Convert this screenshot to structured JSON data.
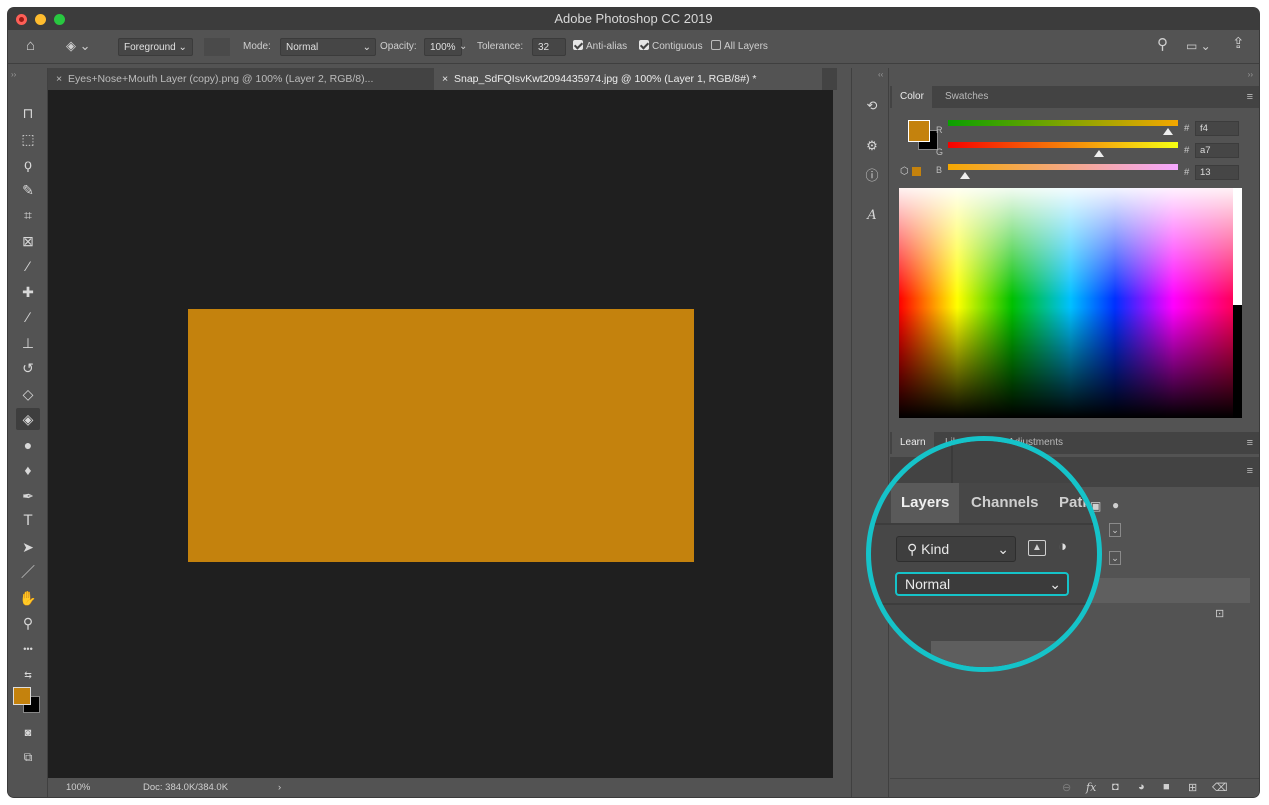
{
  "window": {
    "title": "Adobe Photoshop CC 2019"
  },
  "options_bar": {
    "fill_source": "Foreground",
    "mode_label": "Mode:",
    "mode_value": "Normal",
    "opacity_label": "Opacity:",
    "opacity_value": "100%",
    "tolerance_label": "Tolerance:",
    "tolerance_value": "32",
    "anti_alias_label": "Anti-alias",
    "anti_alias_checked": true,
    "contiguous_label": "Contiguous",
    "contiguous_checked": true,
    "all_layers_label": "All Layers",
    "all_layers_checked": false
  },
  "document_tabs": [
    {
      "label": "Eyes+Nose+Mouth Layer (copy).png @ 100% (Layer 2, RGB/8)...",
      "active": false
    },
    {
      "label": "Snap_SdFQIsvKwt2094435974.jpg @ 100% (Layer 1, RGB/8#) *",
      "active": true
    }
  ],
  "tools": [
    "artboard-tool-icon",
    "marquee-tool-icon",
    "lasso-tool-icon",
    "quick-selection-tool-icon",
    "crop-tool-icon",
    "frame-tool-icon",
    "eyedropper-tool-icon",
    "healing-brush-tool-icon",
    "brush-tool-icon",
    "clone-stamp-tool-icon",
    "history-brush-tool-icon",
    "eraser-tool-icon",
    "paint-bucket-tool-icon",
    "blur-tool-icon",
    "dodge-tool-icon",
    "pen-tool-icon",
    "type-tool-icon",
    "path-selection-tool-icon",
    "line-tool-icon",
    "hand-tool-icon",
    "zoom-tool-icon",
    "more-tools-icon"
  ],
  "selected_tool": "paint-bucket-tool-icon",
  "canvas": {
    "fill_color": "#c4820d"
  },
  "status_bar": {
    "zoom": "100%",
    "doc_size": "Doc: 384.0K/384.0K"
  },
  "color_panel": {
    "tabs": [
      "Color",
      "Swatches"
    ],
    "active_tab": "Color",
    "foreground": "#c4820d",
    "background": "#000000",
    "r_label": "R",
    "g_label": "G",
    "b_label": "B",
    "hash": "#",
    "r_value": "f4",
    "g_value": "a7",
    "b_value": "13",
    "r_level": 0.955,
    "g_level": 0.655,
    "b_level": 0.075
  },
  "learn_panel": {
    "tabs": [
      "Learn",
      "Libraries",
      "Adjustments"
    ],
    "active_tab": "Learn"
  },
  "layers_panel": {
    "tabs": [
      "Layers",
      "Channels",
      "Paths"
    ],
    "active_tab": "Layers",
    "filter_kind": "Kind",
    "blend_mode": "Normal"
  },
  "accent_color": "#15c3c9"
}
